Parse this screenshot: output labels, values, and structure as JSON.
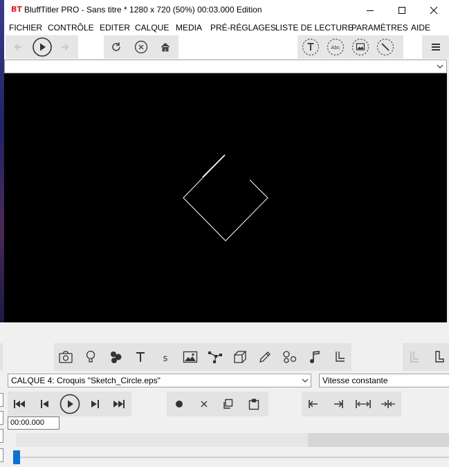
{
  "window": {
    "logo_text": "BT",
    "title": "BluffTitler PRO  - Sans titre * 1280 x 720 (50%) 00:03.000 Edition"
  },
  "menu": [
    "FICHIER",
    "CONTRÔLE",
    "EDITER",
    "CALQUE",
    "MEDIA",
    "PRÉ-RÉGLAGES",
    "LISTE DE LECTURE",
    "PARAMÈTRES",
    "AIDE"
  ],
  "toolbar": {
    "icons": [
      "back-arrow-icon",
      "play-circle-icon",
      "forward-arrow-icon",
      "refresh-icon",
      "stop-circle-icon",
      "home-icon",
      "text-layer-icon",
      "abc-icon",
      "picture-icon",
      "magic-wand-icon",
      "hamburger-menu-icon"
    ]
  },
  "preset_select": {
    "value": ""
  },
  "layer_types": [
    "camera-icon",
    "light-bulb-icon",
    "particles-icon",
    "text-icon",
    "small-text-icon",
    "image-icon",
    "path-icon",
    "cube-icon",
    "pencil-icon",
    "emitter-icon",
    "music-icon",
    "corner-icon"
  ],
  "layer": {
    "selected": "CALQUE 4: Croquis \"Sketch_Circle.eps\"",
    "speed": "Vitesse constante"
  },
  "time": {
    "value": "00:00.000"
  },
  "colors": {
    "accent": "#0a73d1",
    "logo": "#d4202a",
    "preview_bg": "#000000",
    "toolbar_group": "#e3e3e3"
  }
}
